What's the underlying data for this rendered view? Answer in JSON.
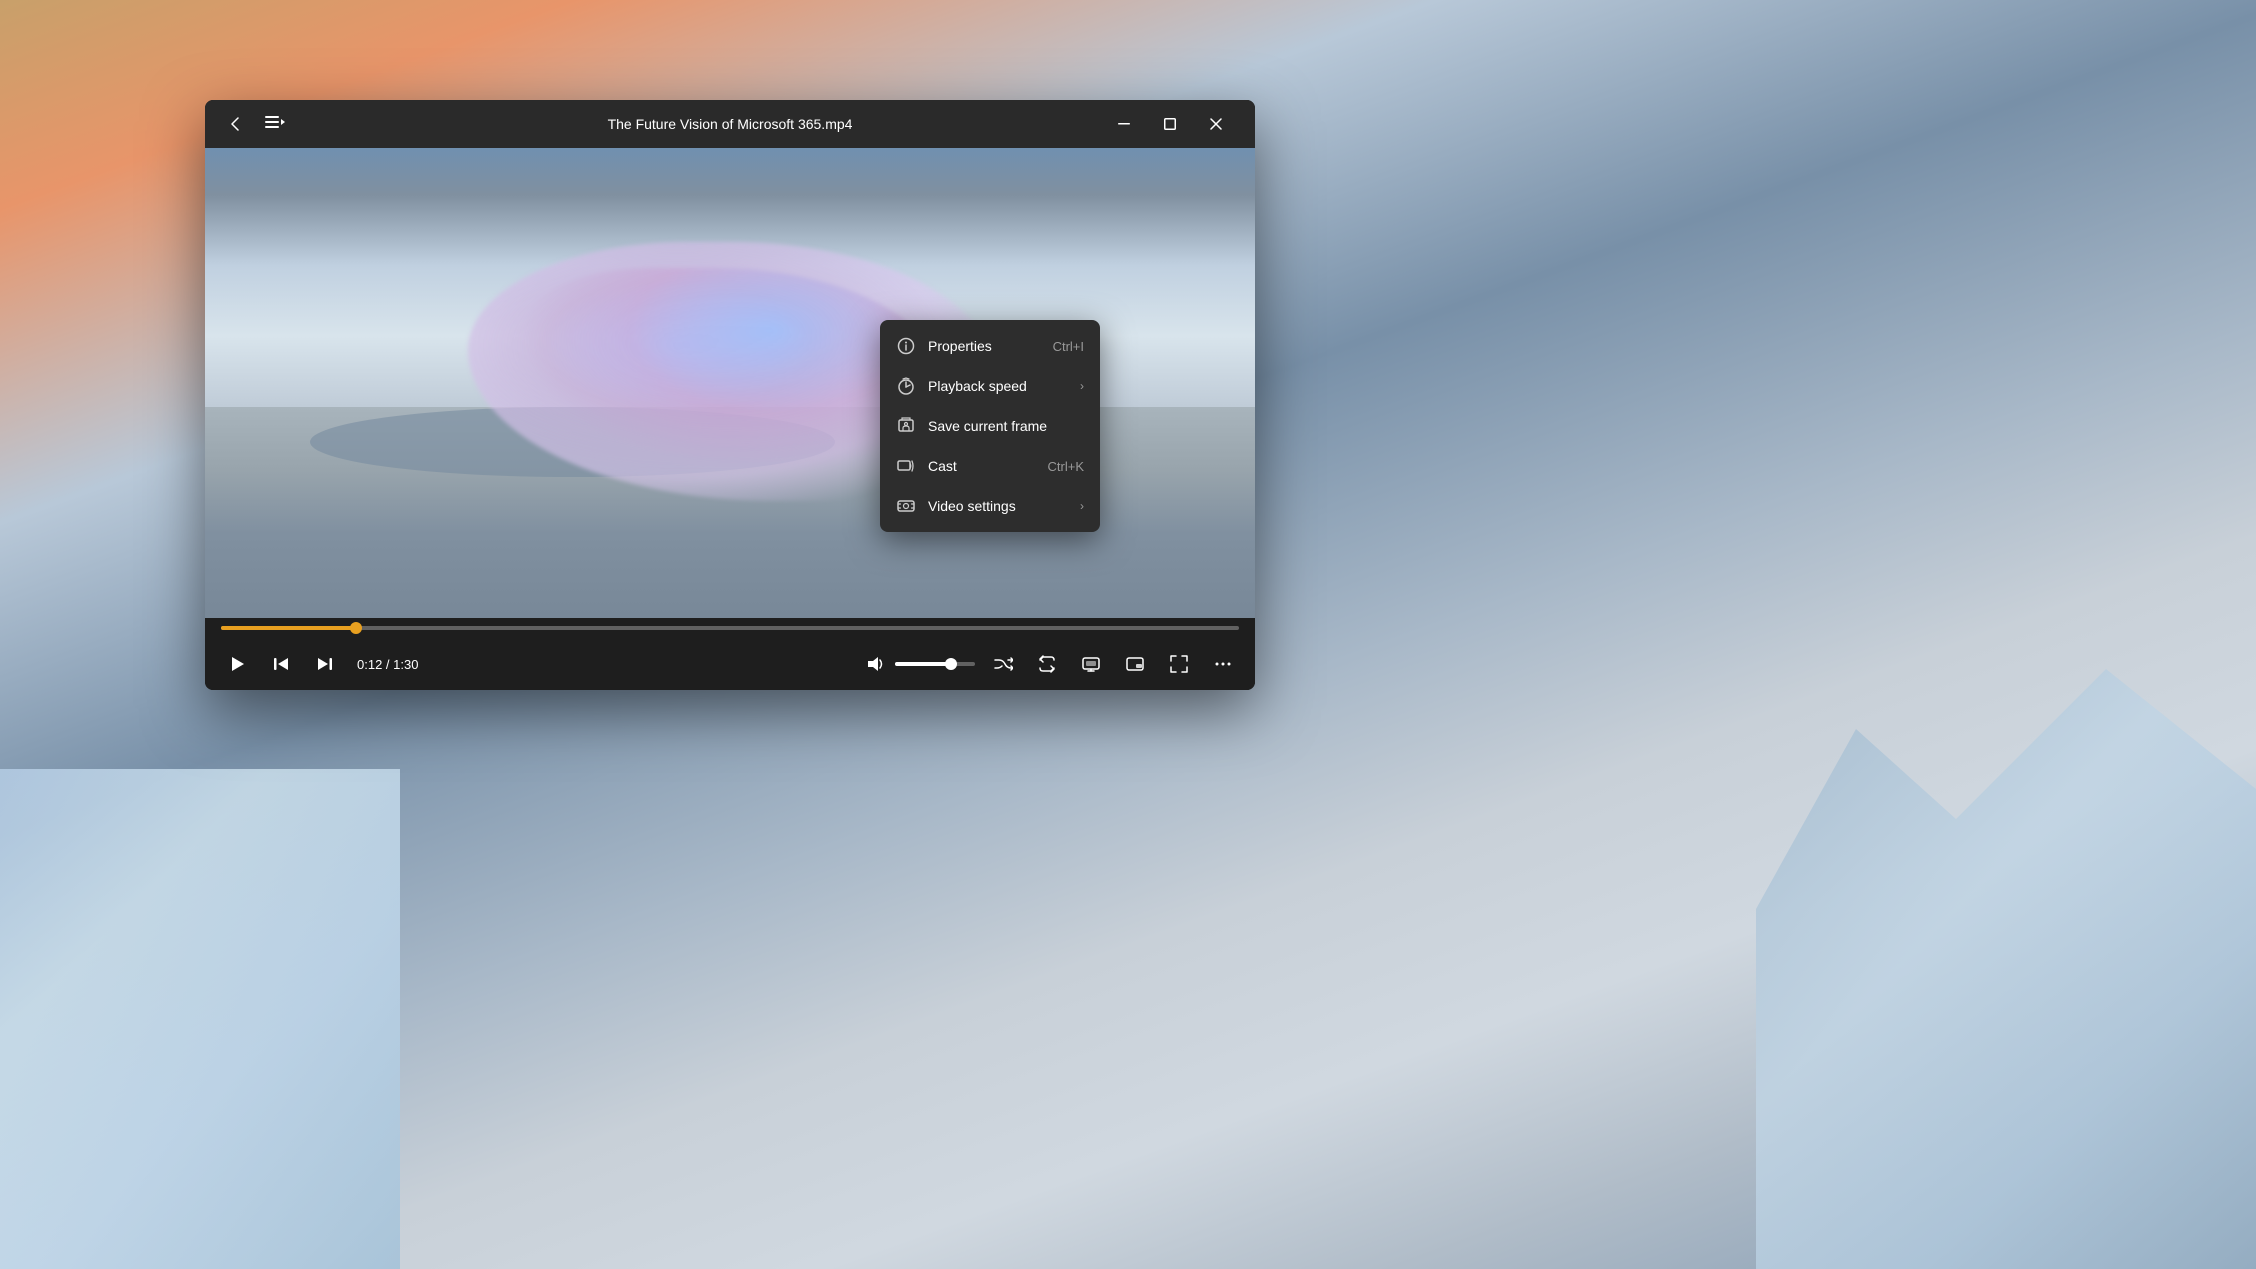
{
  "background": {
    "type": "wallpaper",
    "description": "icy landscape with pink sunset clouds"
  },
  "window": {
    "title": "The Future Vision of Microsoft 365.mp4",
    "titlebar": {
      "back_label": "←",
      "playlist_label": "☰",
      "min_label": "─",
      "max_label": "□",
      "close_label": "✕"
    },
    "controls": {
      "play_label": "▶",
      "prev_label": "⏮",
      "next_label": "⏭",
      "current_time": "0:12",
      "total_time": "1:30",
      "time_display": "0:12 / 1:30",
      "volume_label": "🔊",
      "shuffle_label": "⇌",
      "repeat_label": "↺",
      "cast_screen_label": "⬡",
      "pip_label": "⊡",
      "fullscreen_label": "⛶",
      "more_label": "…",
      "progress_percent": 13.3,
      "volume_percent": 70
    }
  },
  "context_menu": {
    "items": [
      {
        "id": "properties",
        "label": "Properties",
        "shortcut": "Ctrl+I",
        "has_arrow": false,
        "icon": "info-icon"
      },
      {
        "id": "playback-speed",
        "label": "Playback speed",
        "shortcut": "",
        "has_arrow": true,
        "icon": "speed-icon"
      },
      {
        "id": "save-frame",
        "label": "Save current frame",
        "shortcut": "",
        "has_arrow": false,
        "icon": "save-frame-icon"
      },
      {
        "id": "cast",
        "label": "Cast",
        "shortcut": "Ctrl+K",
        "has_arrow": false,
        "icon": "cast-icon"
      },
      {
        "id": "video-settings",
        "label": "Video settings",
        "shortcut": "",
        "has_arrow": true,
        "icon": "video-settings-icon"
      }
    ]
  }
}
